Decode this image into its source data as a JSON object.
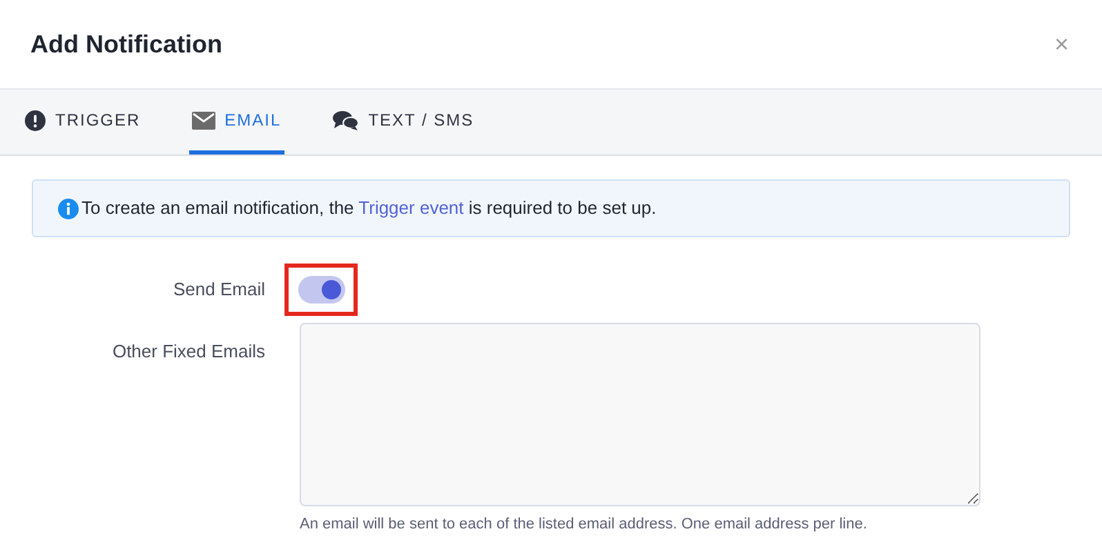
{
  "dialog": {
    "title": "Add Notification",
    "close": "×"
  },
  "tabs": [
    {
      "label": "TRIGGER",
      "kind": "alert",
      "selected": false
    },
    {
      "label": "EMAIL",
      "kind": "mail",
      "selected": true
    },
    {
      "label": "TEXT / SMS",
      "kind": "chat",
      "selected": false
    }
  ],
  "info": {
    "before": "To create an email notification, the ",
    "link": "Trigger event",
    "after": " is required to be set up."
  },
  "send_email": {
    "label": "Send Email",
    "on": true,
    "highlighted": true
  },
  "fixed_emails": {
    "label": "Other Fixed Emails",
    "help": "An email will be sent to each of the listed email address. One email address per line."
  }
}
